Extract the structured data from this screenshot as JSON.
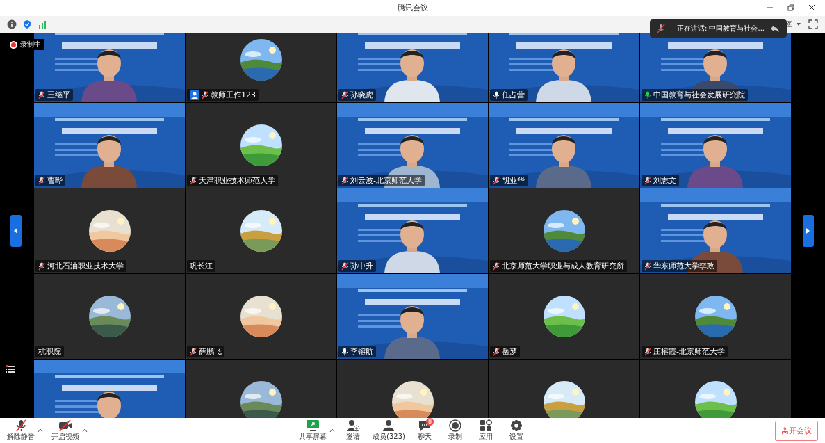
{
  "window": {
    "title": "腾讯会议"
  },
  "top_toolbar": {
    "view_label": "图"
  },
  "recording": {
    "label": "录制中"
  },
  "speaking_toast": {
    "text": "正在讲话: 中国教育与社会..."
  },
  "tiles": [
    {
      "kind": "video",
      "name": "王继平",
      "mic": {
        "muted": true,
        "speaking": false
      }
    },
    {
      "kind": "avatar",
      "name": "教师工作123",
      "mic": {
        "muted": true,
        "speaking": false
      },
      "user_badge": true
    },
    {
      "kind": "video",
      "name": "孙晓虎",
      "mic": {
        "muted": true,
        "speaking": false
      }
    },
    {
      "kind": "video",
      "name": "任占营",
      "mic": {
        "muted": false,
        "speaking": false
      }
    },
    {
      "kind": "video",
      "name": "中国教育与社会发展研究院",
      "mic": {
        "muted": false,
        "speaking": true
      }
    },
    {
      "kind": "video",
      "name": "曹晔",
      "mic": {
        "muted": true,
        "speaking": false
      }
    },
    {
      "kind": "avatar",
      "name": "天津职业技术师范大学",
      "mic": {
        "muted": true,
        "speaking": false
      }
    },
    {
      "kind": "video",
      "name": "刘云波-北京师范大学",
      "mic": {
        "muted": true,
        "speaking": false
      }
    },
    {
      "kind": "video",
      "name": "胡业华",
      "mic": {
        "muted": true,
        "speaking": false
      }
    },
    {
      "kind": "video",
      "name": "刘志文",
      "mic": {
        "muted": true,
        "speaking": false
      }
    },
    {
      "kind": "avatar",
      "name": "河北石油职业技术大学",
      "mic": {
        "muted": true,
        "speaking": false
      }
    },
    {
      "kind": "avatar",
      "name": "巩长江"
    },
    {
      "kind": "video",
      "name": "孙中升",
      "mic": {
        "muted": true,
        "speaking": false
      }
    },
    {
      "kind": "avatar",
      "name": "北京师范大学职业与成人教育研究所",
      "mic": {
        "muted": true,
        "speaking": false
      }
    },
    {
      "kind": "video",
      "name": "华东师范大学李政",
      "mic": {
        "muted": true,
        "speaking": false
      }
    },
    {
      "kind": "avatar",
      "name": "杭职院"
    },
    {
      "kind": "avatar",
      "name": "薛鹏飞",
      "mic": {
        "muted": true,
        "speaking": false
      }
    },
    {
      "kind": "video",
      "name": "李镕航",
      "mic": {
        "muted": false,
        "speaking": false
      }
    },
    {
      "kind": "avatar",
      "name": "岳梦",
      "mic": {
        "muted": true,
        "speaking": false
      }
    },
    {
      "kind": "avatar",
      "name": "庄榕霞-北京师范大学",
      "mic": {
        "muted": true,
        "speaking": false
      }
    },
    {
      "kind": "video"
    },
    {
      "kind": "avatar"
    },
    {
      "kind": "avatar"
    },
    {
      "kind": "avatar"
    },
    {
      "kind": "avatar"
    }
  ],
  "toolbar_left": [
    {
      "label": "解除静音",
      "kind": "mic"
    },
    {
      "label": "开启视频",
      "kind": "camera"
    }
  ],
  "toolbar_center": [
    {
      "label": "共享屏幕",
      "kind": "share",
      "caret": true
    },
    {
      "label": "邀请",
      "kind": "invite"
    },
    {
      "label": "成员(323)",
      "kind": "members"
    },
    {
      "label": "聊天",
      "kind": "chat",
      "badge": "8"
    },
    {
      "label": "录制",
      "kind": "record"
    },
    {
      "label": "应用",
      "kind": "apps"
    },
    {
      "label": "设置",
      "kind": "settings"
    }
  ],
  "leave_button": {
    "label": "离开会议"
  }
}
